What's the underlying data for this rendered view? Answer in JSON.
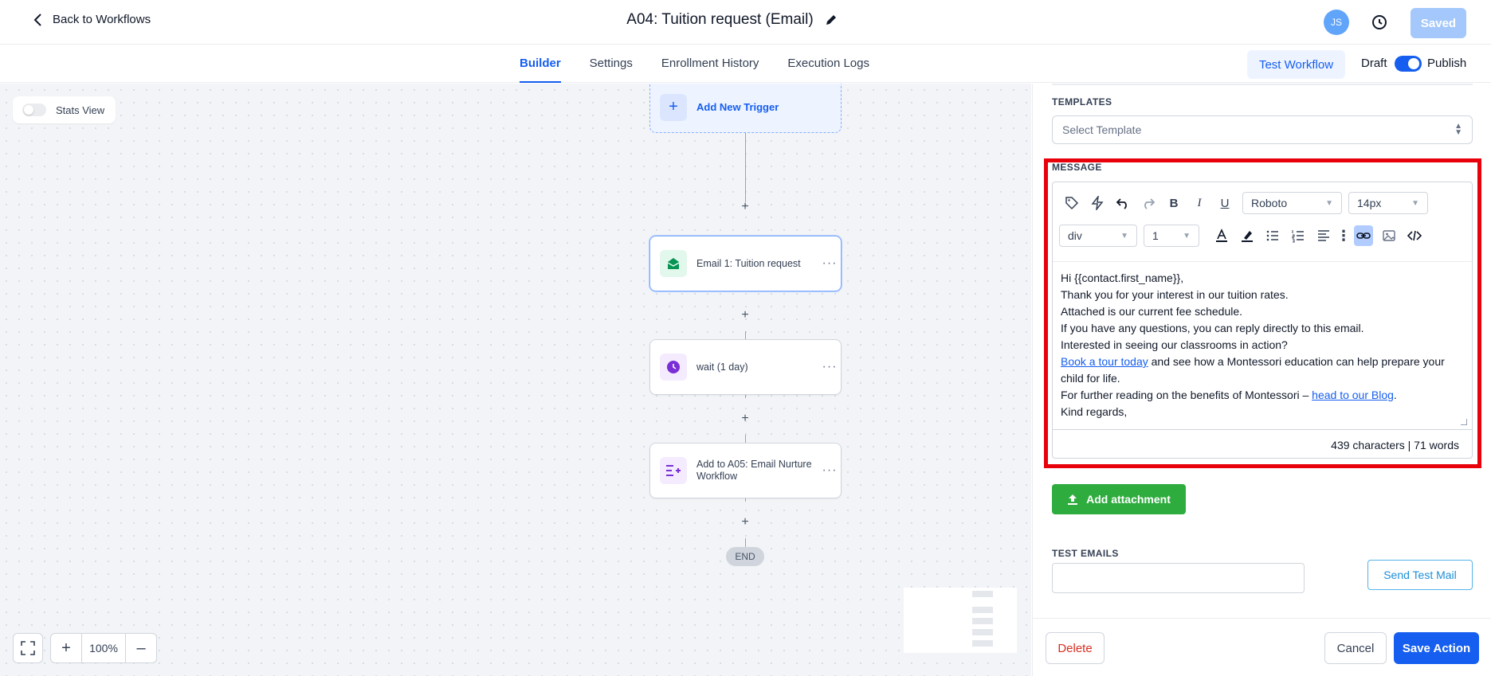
{
  "header": {
    "back_label": "Back to Workflows",
    "title": "A04: Tuition request (Email)",
    "avatar_initials": "JS",
    "saved_label": "Saved"
  },
  "tabs": [
    {
      "label": "Builder",
      "active": true
    },
    {
      "label": "Settings"
    },
    {
      "label": "Enrollment History"
    },
    {
      "label": "Execution Logs"
    }
  ],
  "tabs_right": {
    "test_workflow_label": "Test Workflow",
    "draft_label": "Draft",
    "publish_label": "Publish"
  },
  "canvas": {
    "stats_view_label": "Stats View",
    "trigger_label": "Add New Trigger",
    "nodes": [
      {
        "label": "Email 1: Tuition request",
        "icon": "email-open-icon",
        "color": "#079455"
      },
      {
        "label": "wait (1 day)",
        "icon": "clock-icon",
        "color": "#7a2ed6"
      },
      {
        "label": "Add to A05: Email Nurture Workflow",
        "icon": "list-add-icon",
        "color": "#7a2ed6"
      }
    ],
    "end_label": "END",
    "zoom_level": "100%",
    "plus_symbol": "+"
  },
  "panel": {
    "templates_label": "TEMPLATES",
    "select_template_placeholder": "Select Template",
    "message_label": "MESSAGE",
    "font_family": "Roboto",
    "font_size": "14px",
    "block_type": "div",
    "line_height": "1",
    "message_lines": {
      "l1": "Hi {{contact.first_name}},",
      "l2": "Thank you for your interest in our tuition rates.",
      "l3": "Attached is our current fee schedule.",
      "l4": "If you have any questions, you can reply directly to this email.",
      "l5": "Interested in seeing our classrooms in action?",
      "l6_link": "Book a tour today",
      "l6_rest": " and see how a Montessori education can help prepare your child for life.",
      "l7_pre": "For further reading on the benefits of Montessori – ",
      "l7_link": "head to our Blog",
      "l7_post": ".",
      "l8": "Kind regards,"
    },
    "char_count": "439 characters | 71 words",
    "add_attachment_label": "Add attachment",
    "test_emails_label": "TEST EMAILS",
    "send_test_mail_label": "Send Test Mail",
    "delete_label": "Delete",
    "cancel_label": "Cancel",
    "save_action_label": "Save Action"
  }
}
